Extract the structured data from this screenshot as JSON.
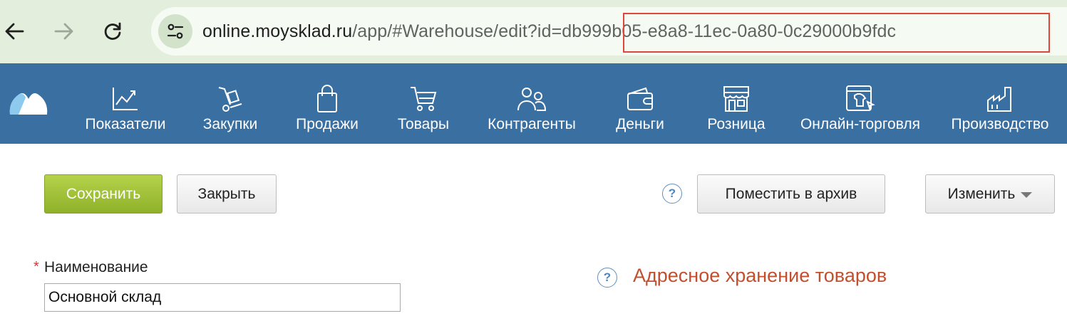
{
  "browser": {
    "url_host": "online.moysklad.ru",
    "url_path": "/app/#Warehouse/edit?id=",
    "url_id": "db999b05-e8a8-11ec-0a80-0c29000b9fdc"
  },
  "nav": {
    "items": [
      {
        "label": "Показатели",
        "icon": "chart-icon"
      },
      {
        "label": "Закупки",
        "icon": "dolly-icon"
      },
      {
        "label": "Продажи",
        "icon": "bag-icon"
      },
      {
        "label": "Товары",
        "icon": "cart-icon"
      },
      {
        "label": "Контрагенты",
        "icon": "people-icon"
      },
      {
        "label": "Деньги",
        "icon": "wallet-icon"
      },
      {
        "label": "Розница",
        "icon": "store-icon"
      },
      {
        "label": "Онлайн-торговля",
        "icon": "online-store-icon"
      },
      {
        "label": "Производство",
        "icon": "factory-icon"
      }
    ]
  },
  "toolbar": {
    "save_label": "Сохранить",
    "close_label": "Закрыть",
    "help_label": "?",
    "archive_label": "Поместить в архив",
    "change_label": "Изменить"
  },
  "form": {
    "required_mark": "*",
    "name_label": "Наименование",
    "name_value": "Основной склад",
    "help_label": "?",
    "section_title": "Адресное хранение товаров"
  },
  "colors": {
    "browser_bar": "#e3eedd",
    "nav_bg": "#3a6fa2",
    "save_button": "#a3c23a",
    "section_title": "#c1502e",
    "highlight_box": "#e0473a"
  }
}
